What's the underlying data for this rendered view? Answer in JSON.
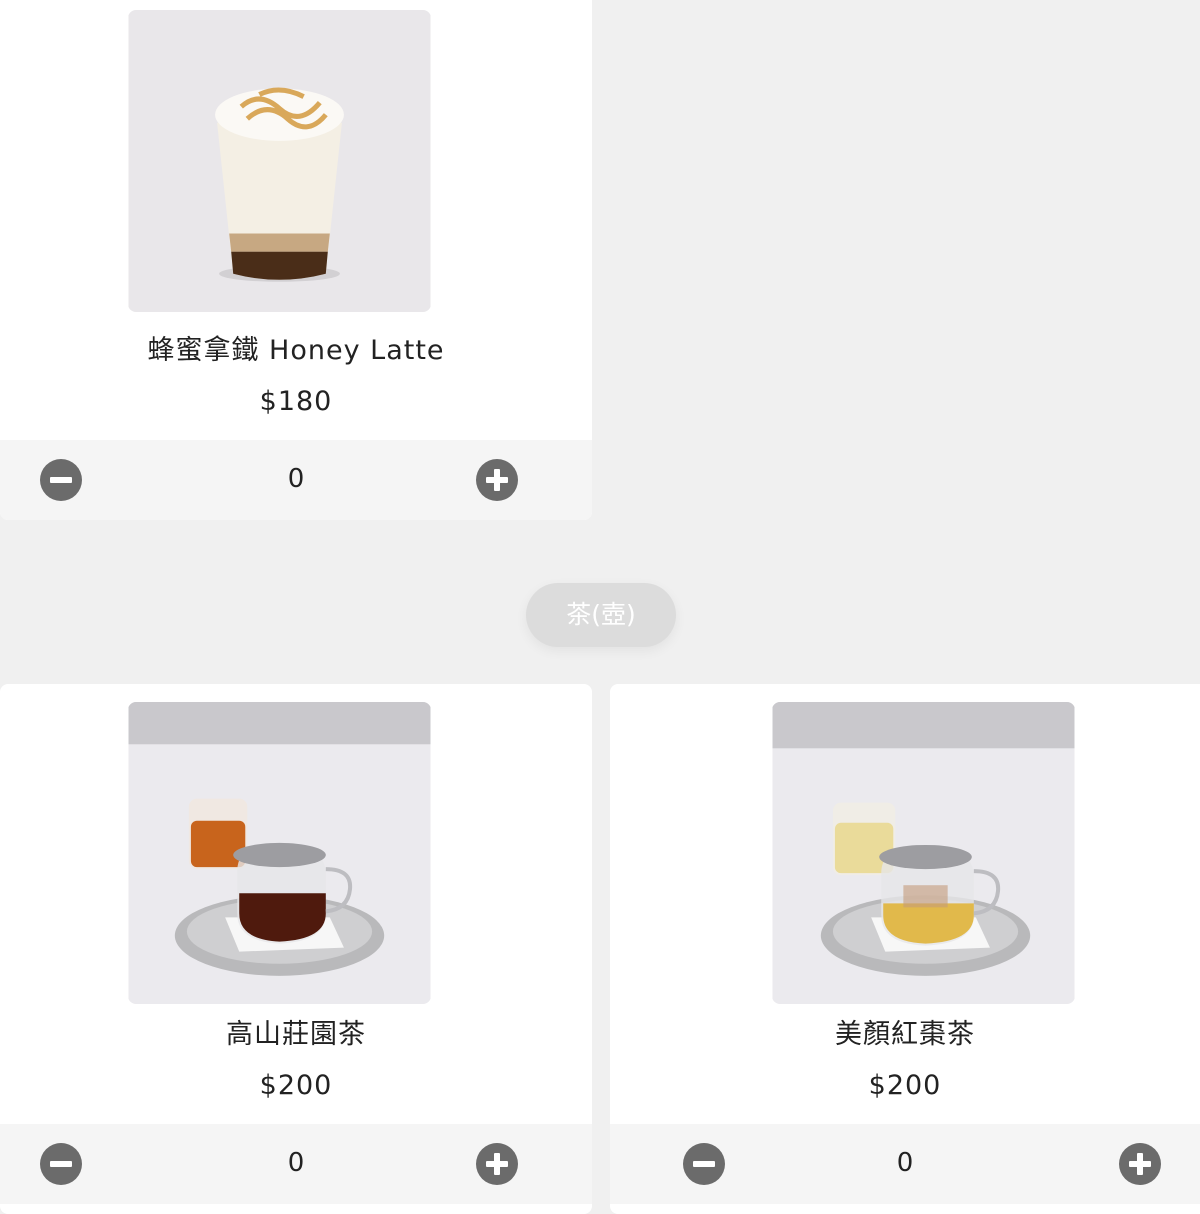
{
  "products": [
    {
      "name": "蜂蜜拿鐵 Honey Latte",
      "price": "$180",
      "quantity": "0"
    },
    {
      "name": "高山莊園茶",
      "price": "$200",
      "quantity": "0"
    },
    {
      "name": "美顏紅棗茶",
      "price": "$200",
      "quantity": "0"
    }
  ],
  "category": {
    "label": "茶(壺)"
  },
  "icons": {
    "decrease": "minus-circle-icon",
    "increase": "plus-circle-icon"
  },
  "colors": {
    "background": "#f0f0f0",
    "card": "#ffffff",
    "button": "#6b6b6b",
    "pill": "#dcdcdc"
  }
}
